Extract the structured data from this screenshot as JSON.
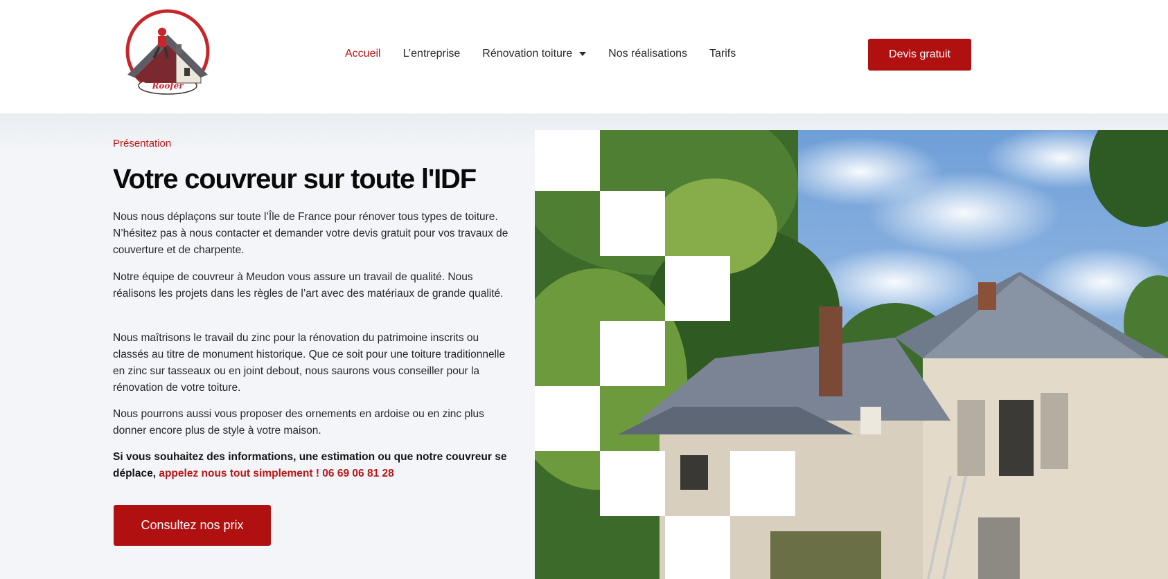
{
  "header": {
    "logo": {
      "text": "Roofer",
      "icon": "roofer-logo-icon"
    },
    "nav": [
      {
        "label": "Accueil",
        "active": true
      },
      {
        "label": "L’entreprise"
      },
      {
        "label": "Rénovation toiture",
        "has_dropdown": true
      },
      {
        "label": "Nos réalisations"
      },
      {
        "label": "Tarifs"
      }
    ],
    "cta_label": "Devis gratuit"
  },
  "hero": {
    "eyebrow": "Présentation",
    "title": "Votre couvreur sur toute l'IDF",
    "paragraphs": [
      "Nous nous déplaçons sur toute l’Île de France pour rénover tous types de toiture. N’hésitez pas à nous contacter et demander votre devis gratuit pour vos travaux de couverture et de charpente.",
      "Notre équipe de couvreur à Meudon vous assure un travail de qualité. Nous réalisons les projets dans les règles de l’art avec des matériaux de grande qualité.",
      "Nous maîtrisons le travail du zinc pour la rénovation du patrimoine inscrits ou classés au titre de monument historique. Que ce soit pour une toiture traditionnelle en zinc sur tasseaux ou en joint debout, nous saurons vous conseiller pour la rénovation de votre toiture.",
      "Nous pourrons aussi vous proposer des ornements en ardoise ou en zinc plus donner encore plus de style à votre maison."
    ],
    "contact_text": "Si vous souhaitez des informations, une estimation ou que notre couvreur se déplace,",
    "contact_link": "appelez nous tout simplement ! 06 69 06 81 28",
    "cta_label": "Consultez nos prix",
    "image": {
      "subject": "house-with-slate-roof-photo"
    }
  },
  "colors": {
    "accent": "#b01010",
    "text": "#1f1f1f",
    "hero_bg": "#f3f5f8"
  }
}
